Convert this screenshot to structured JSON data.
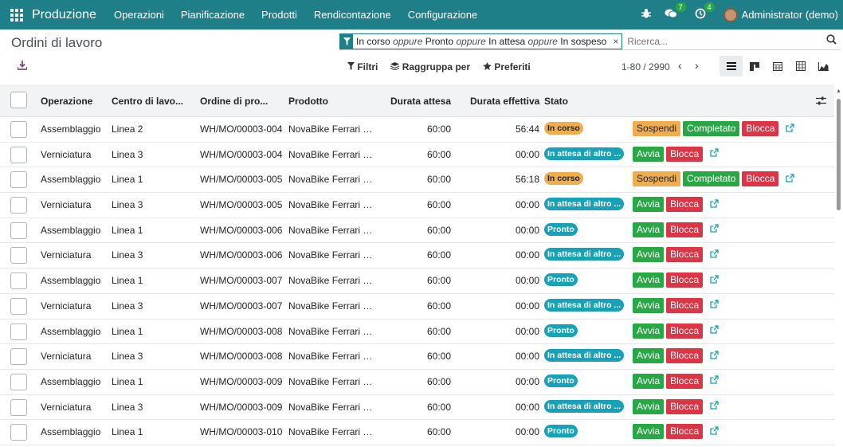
{
  "navbar": {
    "brand": "Produzione",
    "menu": [
      "Operazioni",
      "Pianificazione",
      "Prodotti",
      "Rendicontazione",
      "Configurazione"
    ],
    "messages_count": "7",
    "activities_count": "4",
    "user": "Administrator (demo)"
  },
  "page": {
    "title": "Ordini di lavoro"
  },
  "search": {
    "facet_part1": "In corso",
    "facet_or1": "oppure",
    "facet_part2": "Pronto",
    "facet_or2": "oppure",
    "facet_part3": "In attesa",
    "facet_or3": "oppure",
    "facet_part4": "In sospeso",
    "placeholder": "Ricerca..."
  },
  "toolbar": {
    "filters": "Filtri",
    "groupby": "Raggruppa per",
    "favorites": "Preferiti",
    "pager": "1-80 / 2990"
  },
  "columns": {
    "operation": "Operazione",
    "workcenter": "Centro di lavo...",
    "mo": "Ordine di pro...",
    "product": "Prodotto",
    "expected": "Durata attesa",
    "duration": "Durata effettiva",
    "state": "Stato"
  },
  "colors": {
    "navbar": "#1f7f89",
    "in_progress": "#f0ad4e",
    "ready": "#17a2b8",
    "start": "#28a745",
    "block": "#dc3545"
  },
  "rows": [
    {
      "operation": "Assemblaggio",
      "workcenter": "Linea 2",
      "mo": "WH/MO/00003-004",
      "product": "NovaBike Ferrari E...",
      "expected": "60:00",
      "duration": "56:44",
      "state": "In corso",
      "state_type": "warn",
      "actions": [
        "Sospendi",
        "Completato",
        "Blocca"
      ]
    },
    {
      "operation": "Verniciatura",
      "workcenter": "Linea 3",
      "mo": "WH/MO/00003-004",
      "product": "NovaBike Ferrari E...",
      "expected": "60:00",
      "duration": "00:00",
      "state": "In attesa di altro ...",
      "state_type": "info",
      "actions": [
        "Avvia",
        "Blocca"
      ]
    },
    {
      "operation": "Assemblaggio",
      "workcenter": "Linea 1",
      "mo": "WH/MO/00003-005",
      "product": "NovaBike Ferrari E...",
      "expected": "60:00",
      "duration": "56:18",
      "state": "In corso",
      "state_type": "warn",
      "actions": [
        "Sospendi",
        "Completato",
        "Blocca"
      ]
    },
    {
      "operation": "Verniciatura",
      "workcenter": "Linea 3",
      "mo": "WH/MO/00003-005",
      "product": "NovaBike Ferrari E...",
      "expected": "60:00",
      "duration": "00:00",
      "state": "In attesa di altro ...",
      "state_type": "info",
      "actions": [
        "Avvia",
        "Blocca"
      ]
    },
    {
      "operation": "Assemblaggio",
      "workcenter": "Linea 1",
      "mo": "WH/MO/00003-006",
      "product": "NovaBike Ferrari E...",
      "expected": "60:00",
      "duration": "00:00",
      "state": "Pronto",
      "state_type": "info",
      "actions": [
        "Avvia",
        "Blocca"
      ]
    },
    {
      "operation": "Verniciatura",
      "workcenter": "Linea 3",
      "mo": "WH/MO/00003-006",
      "product": "NovaBike Ferrari E...",
      "expected": "60:00",
      "duration": "00:00",
      "state": "In attesa di altro ...",
      "state_type": "info",
      "actions": [
        "Avvia",
        "Blocca"
      ]
    },
    {
      "operation": "Assemblaggio",
      "workcenter": "Linea 1",
      "mo": "WH/MO/00003-007",
      "product": "NovaBike Ferrari E...",
      "expected": "60:00",
      "duration": "00:00",
      "state": "Pronto",
      "state_type": "info",
      "actions": [
        "Avvia",
        "Blocca"
      ]
    },
    {
      "operation": "Verniciatura",
      "workcenter": "Linea 3",
      "mo": "WH/MO/00003-007",
      "product": "NovaBike Ferrari E...",
      "expected": "60:00",
      "duration": "00:00",
      "state": "In attesa di altro ...",
      "state_type": "info",
      "actions": [
        "Avvia",
        "Blocca"
      ]
    },
    {
      "operation": "Assemblaggio",
      "workcenter": "Linea 1",
      "mo": "WH/MO/00003-008",
      "product": "NovaBike Ferrari E...",
      "expected": "60:00",
      "duration": "00:00",
      "state": "Pronto",
      "state_type": "info",
      "actions": [
        "Avvia",
        "Blocca"
      ]
    },
    {
      "operation": "Verniciatura",
      "workcenter": "Linea 3",
      "mo": "WH/MO/00003-008",
      "product": "NovaBike Ferrari E...",
      "expected": "60:00",
      "duration": "00:00",
      "state": "In attesa di altro ...",
      "state_type": "info",
      "actions": [
        "Avvia",
        "Blocca"
      ]
    },
    {
      "operation": "Assemblaggio",
      "workcenter": "Linea 1",
      "mo": "WH/MO/00003-009",
      "product": "NovaBike Ferrari E...",
      "expected": "60:00",
      "duration": "00:00",
      "state": "Pronto",
      "state_type": "info",
      "actions": [
        "Avvia",
        "Blocca"
      ]
    },
    {
      "operation": "Verniciatura",
      "workcenter": "Linea 3",
      "mo": "WH/MO/00003-009",
      "product": "NovaBike Ferrari E...",
      "expected": "60:00",
      "duration": "00:00",
      "state": "In attesa di altro ...",
      "state_type": "info",
      "actions": [
        "Avvia",
        "Blocca"
      ]
    },
    {
      "operation": "Assemblaggio",
      "workcenter": "Linea 1",
      "mo": "WH/MO/00003-010",
      "product": "NovaBike Ferrari E...",
      "expected": "60:00",
      "duration": "00:00",
      "state": "Pronto",
      "state_type": "info",
      "actions": [
        "Avvia",
        "Blocca"
      ]
    }
  ]
}
